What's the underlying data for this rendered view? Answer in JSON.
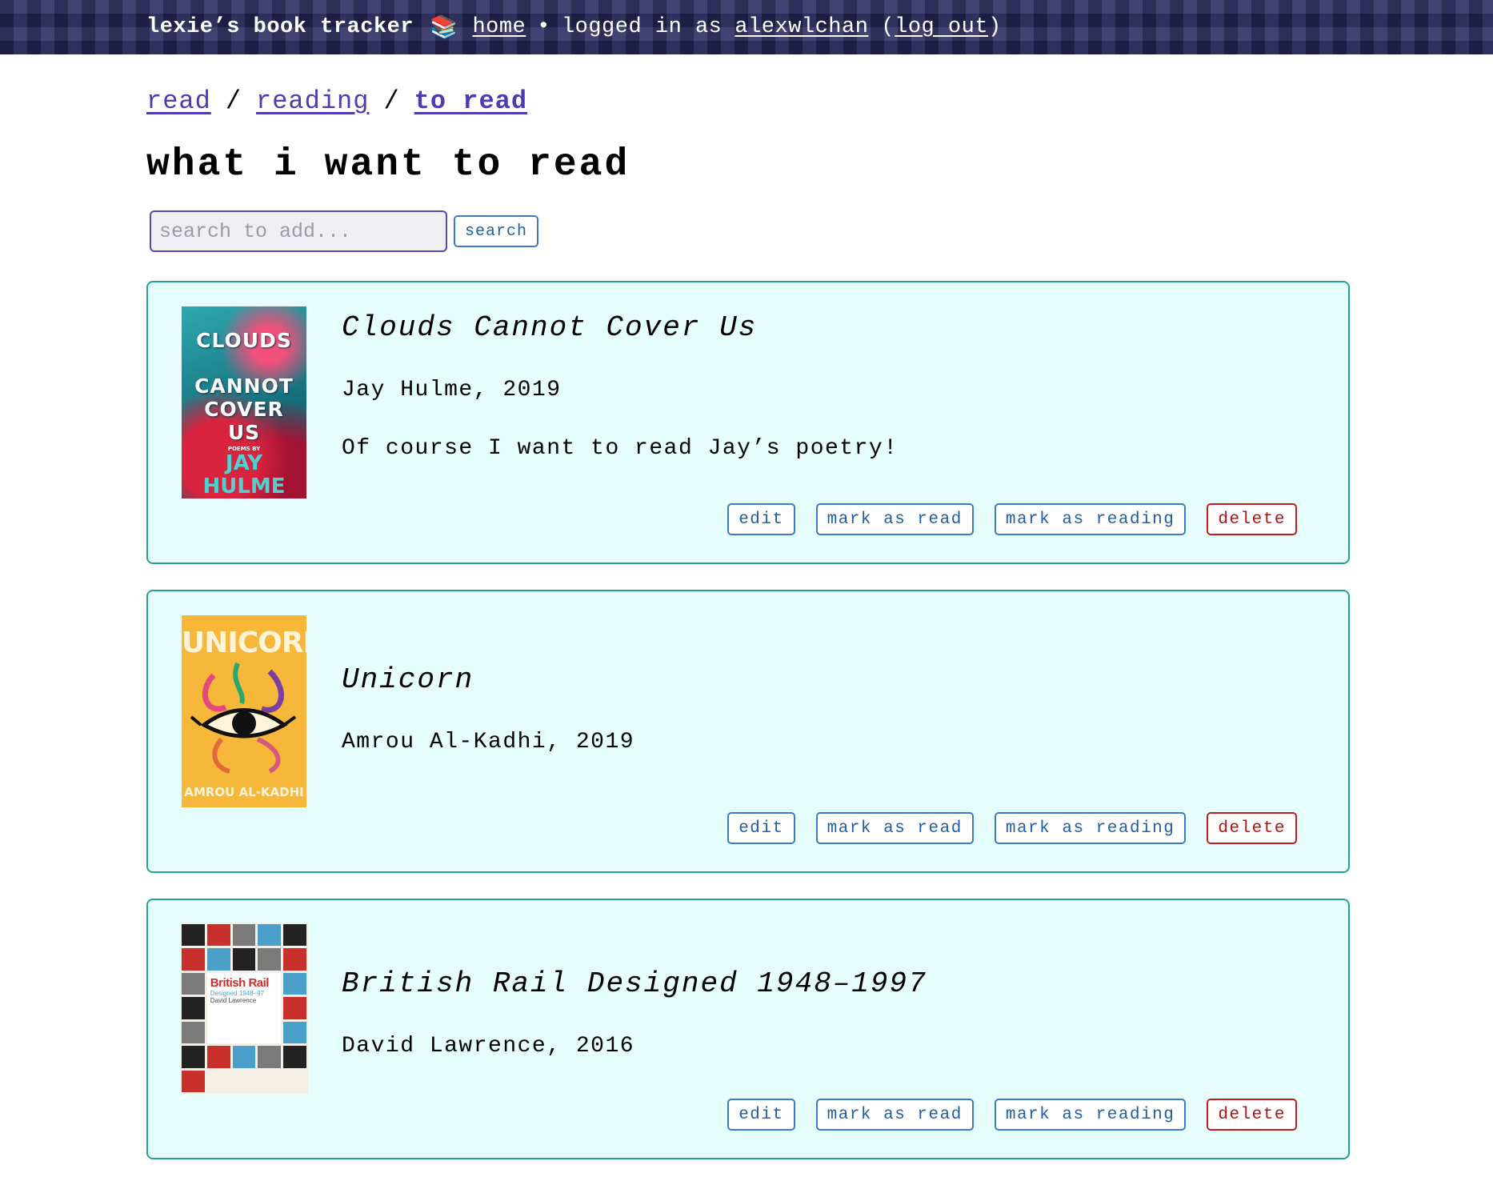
{
  "header": {
    "site_title": "lexie’s book tracker",
    "books_icon": "📚",
    "home_link": "home",
    "separator": "•",
    "logged_in_prefix": "logged in as",
    "username": "alexwlchan",
    "logout_open": "(",
    "logout_link": "log out",
    "logout_close": ")"
  },
  "breadcrumb": {
    "items": [
      "read",
      "reading",
      "to read"
    ],
    "separator": "/"
  },
  "page_title": "what i want to read",
  "search": {
    "placeholder": "search to add...",
    "value": "",
    "button_label": "search"
  },
  "books": [
    {
      "title": "Clouds Cannot Cover Us",
      "author_year": "Jay Hulme, 2019",
      "note": "Of course I want to read Jay’s poetry!",
      "cover": {
        "title_lines": [
          "CLOUDS",
          "CANNOT",
          "COVER",
          "US"
        ],
        "subtitle": "POEMS BY",
        "author_lines": [
          "JAY",
          "HULME"
        ]
      }
    },
    {
      "title": "Unicorn",
      "author_year": "Amrou Al-Kadhi, 2019",
      "note": "",
      "cover": {
        "title": "UNICORN",
        "author": "AMROU AL-KADHI"
      }
    },
    {
      "title": "British Rail Designed 1948–1997",
      "author_year": "David Lawrence, 2016",
      "note": "",
      "cover": {
        "title": "British Rail",
        "subtitle": "Designed 1948–97",
        "author": "David Lawrence"
      }
    }
  ],
  "actions": {
    "edit": "edit",
    "mark_read": "mark as read",
    "mark_reading": "mark as reading",
    "delete": "delete"
  },
  "colors": {
    "header_bg": "#2c2c63",
    "link": "#4d3bb3",
    "card_bg": "#e5fdfb",
    "card_border": "#23a591",
    "button_blue": "#1f5fa8",
    "button_red": "#b31212"
  }
}
